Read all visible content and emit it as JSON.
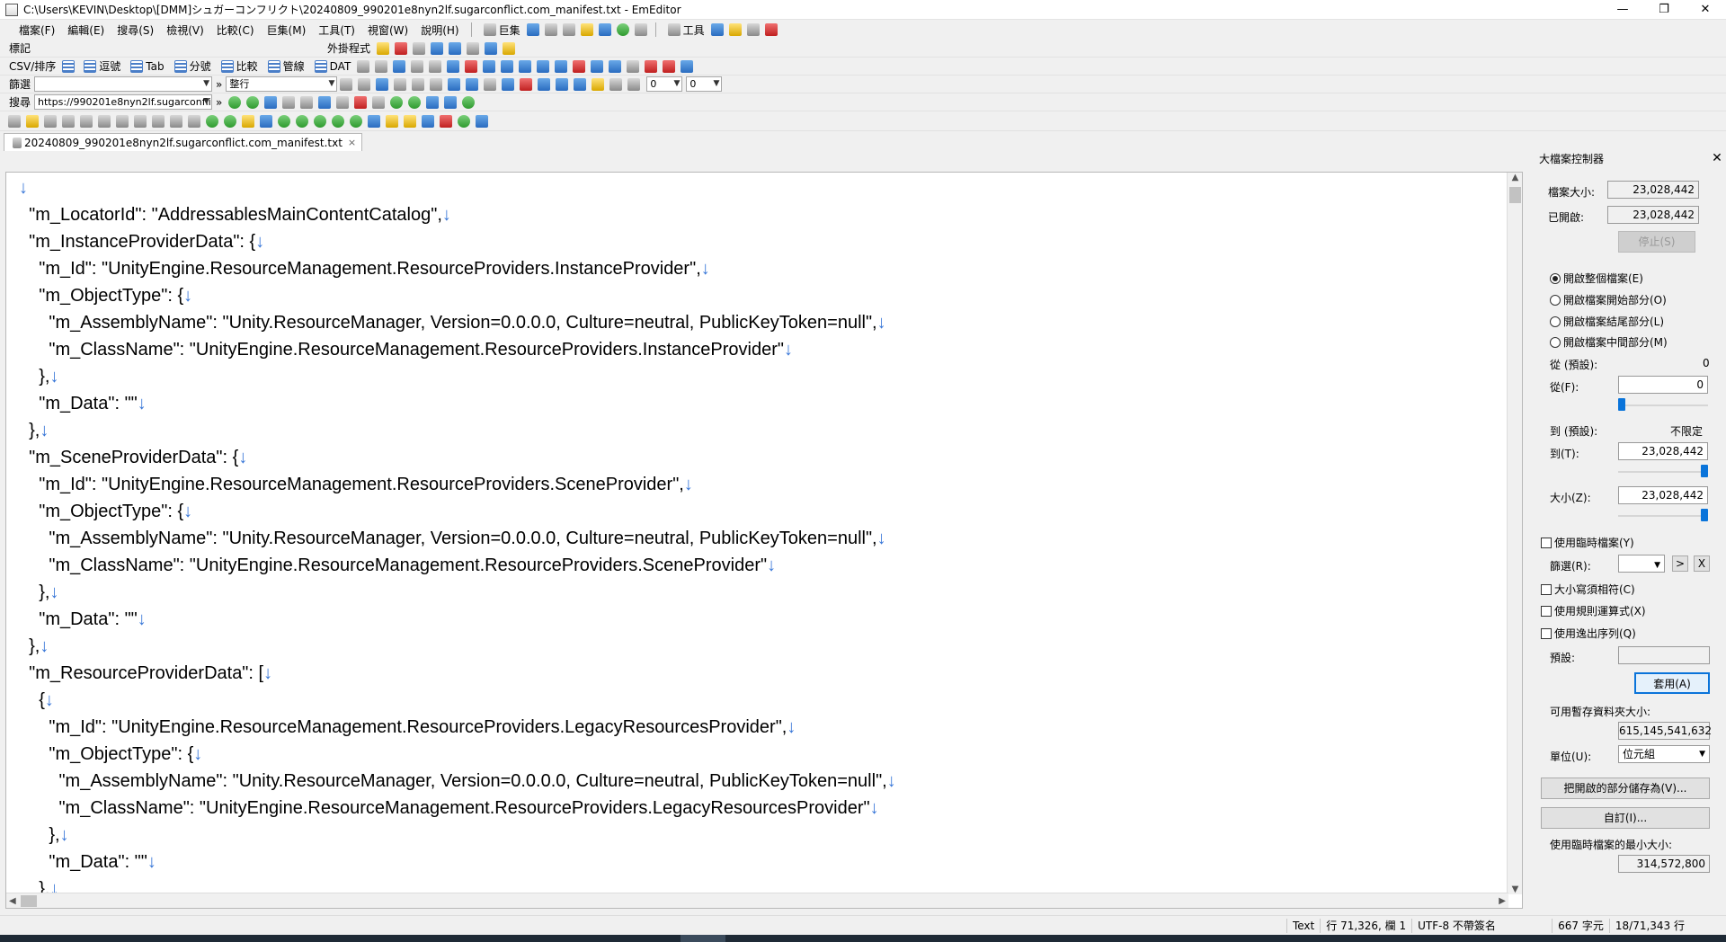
{
  "window": {
    "title": "C:\\Users\\KEVIN\\Desktop\\[DMM]シュガーコンフリクト\\20240809_990201e8nyn2lf.sugarconflict.com_manifest.txt - EmEditor",
    "minimize": "—",
    "restore": "❐",
    "close": "✕"
  },
  "menu": {
    "items": [
      "檔案(F)",
      "編輯(E)",
      "搜尋(S)",
      "檢視(V)",
      "比較(C)",
      "巨集(M)",
      "工具(T)",
      "視窗(W)",
      "說明(H)"
    ],
    "macro_label": "巨集",
    "tools_label": "工具"
  },
  "toolbars": {
    "bookmark_label": "標記",
    "plugins_label": "外掛程式",
    "csv_label": "CSV/排序",
    "csv_buttons": [
      "逗號",
      "Tab",
      "分號",
      "比較",
      "管線",
      "DAT"
    ],
    "filter_label": "篩選",
    "filter_mode": "整行",
    "spin1": "0",
    "spin2": "0",
    "search_label": "搜尋",
    "search_value": "https://990201e8nyn2lf.sugarconflict"
  },
  "tab": {
    "label": "20240809_990201e8nyn2lf.sugarconflict.com_manifest.txt",
    "close": "×"
  },
  "editor": {
    "eol": "↓",
    "lines": [
      "",
      "  \"m_LocatorId\": \"AddressablesMainContentCatalog\",",
      "  \"m_InstanceProviderData\": {",
      "    \"m_Id\": \"UnityEngine.ResourceManagement.ResourceProviders.InstanceProvider\",",
      "    \"m_ObjectType\": {",
      "      \"m_AssemblyName\": \"Unity.ResourceManager, Version=0.0.0.0, Culture=neutral, PublicKeyToken=null\",",
      "      \"m_ClassName\": \"UnityEngine.ResourceManagement.ResourceProviders.InstanceProvider\"",
      "    },",
      "    \"m_Data\": \"\"",
      "  },",
      "  \"m_SceneProviderData\": {",
      "    \"m_Id\": \"UnityEngine.ResourceManagement.ResourceProviders.SceneProvider\",",
      "    \"m_ObjectType\": {",
      "      \"m_AssemblyName\": \"Unity.ResourceManager, Version=0.0.0.0, Culture=neutral, PublicKeyToken=null\",",
      "      \"m_ClassName\": \"UnityEngine.ResourceManagement.ResourceProviders.SceneProvider\"",
      "    },",
      "    \"m_Data\": \"\"",
      "  },",
      "  \"m_ResourceProviderData\": [",
      "    {",
      "      \"m_Id\": \"UnityEngine.ResourceManagement.ResourceProviders.LegacyResourcesProvider\",",
      "      \"m_ObjectType\": {",
      "        \"m_AssemblyName\": \"Unity.ResourceManager, Version=0.0.0.0, Culture=neutral, PublicKeyToken=null\",",
      "        \"m_ClassName\": \"UnityEngine.ResourceManagement.ResourceProviders.LegacyResourcesProvider\"",
      "      },",
      "      \"m_Data\": \"\"",
      "    },"
    ]
  },
  "panel": {
    "title": "大檔案控制器",
    "close": "✕",
    "file_size_label": "檔案大小:",
    "file_size": "23,028,442",
    "opened_label": "已開啟:",
    "opened": "23,028,442",
    "stop_button": "停止(S)",
    "radios": [
      "開啟整個檔案(E)",
      "開啟檔案開始部分(O)",
      "開啟檔案結尾部分(L)",
      "開啟檔案中間部分(M)"
    ],
    "from_default_label": "從 (預設):",
    "from_default": "0",
    "from_label": "從(F):",
    "from_value": "0",
    "to_default_label": "到 (預設):",
    "to_default": "不限定",
    "to_label": "到(T):",
    "to_value": "23,028,442",
    "size_label": "大小(Z):",
    "size_value": "23,028,442",
    "use_temp_label": "使用臨時檔案(Y)",
    "filter_label": "篩選(R):",
    "filter_next": ">",
    "filter_clear": "X",
    "match_case": "大小寫須相符(C)",
    "use_regex": "使用規則運算式(X)",
    "use_escape": "使用逸出序列(Q)",
    "default_label": "預設:",
    "apply_button": "套用(A)",
    "avail_label": "可用暫存資料夾大小:",
    "avail_value": "615,145,541,632",
    "unit_label": "單位(U):",
    "unit_value": "位元組",
    "save_part_button": "把開啟的部分儲存為(V)...",
    "custom_button": "自訂(I)...",
    "min_temp_label": "使用臨時檔案的最小大小:",
    "min_temp_value": "314,572,800"
  },
  "status": {
    "mode": "Text",
    "position": "行 71,326, 欄 1",
    "encoding": "UTF-8 不帶簽名",
    "chars": "667 字元",
    "lines": "18/71,343 行"
  }
}
